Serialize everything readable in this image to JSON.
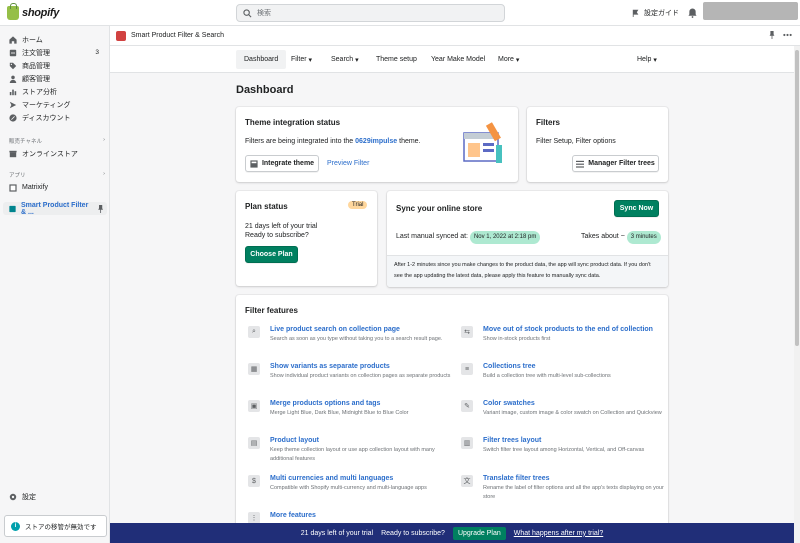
{
  "topbar": {
    "logo": "shopify",
    "search_placeholder": "検索",
    "setup_label": "設定ガイド"
  },
  "sidebar": {
    "items": [
      {
        "label": "ホーム",
        "icon": "home-icon"
      },
      {
        "label": "注文管理",
        "icon": "orders-icon",
        "badge": "3"
      },
      {
        "label": "商品管理",
        "icon": "tag-icon"
      },
      {
        "label": "顧客管理",
        "icon": "person-icon"
      },
      {
        "label": "ストア分析",
        "icon": "analytics-icon"
      },
      {
        "label": "マーケティング",
        "icon": "marketing-icon"
      },
      {
        "label": "ディスカウント",
        "icon": "discount-icon"
      }
    ],
    "channels_heading": "販売チャネル",
    "online_store": "オンラインストア",
    "apps_heading": "アプリ",
    "matrixify": "Matrixify",
    "current_app": "Smart Product Filter & ...",
    "settings": "設定",
    "notice": "ストアの移管が無効です"
  },
  "app_header": {
    "title": "Smart Product Filter & Search"
  },
  "app_nav": {
    "tabs": [
      "Dashboard",
      "Filter",
      "Search",
      "Theme setup",
      "Year Make Model",
      "More"
    ],
    "help": "Help"
  },
  "page": {
    "title": "Dashboard"
  },
  "theme_card": {
    "title": "Theme integration status",
    "text_before": "Filters are being integrated into the",
    "theme_name": "0629impulse",
    "text_after": "theme.",
    "integrate_button": "Integrate theme",
    "preview_link": "Preview Filter"
  },
  "filters_card": {
    "title": "Filters",
    "subtitle": "Filter Setup, Filter options",
    "button": "Manager Filter trees"
  },
  "plan_card": {
    "title": "Plan status",
    "badge": "Trial",
    "line1": "21 days left of your trial",
    "line2": "Ready to subscribe?",
    "button": "Choose Plan"
  },
  "sync_card": {
    "title": "Sync your online store",
    "button": "Sync Now",
    "last_synced_label": "Last manual synced at:",
    "last_synced_value": "Nov 1, 2022 at 2:18 pm",
    "takes_label": "Takes about ~",
    "takes_value": "3 minutes",
    "note": "After 1-2 minutes since you make changes to the product data, the app will sync product data. If you don't see the app updating the latest data, please apply this feature to manually sync data."
  },
  "features": {
    "title": "Filter features",
    "items": [
      {
        "title": "Live product search on collection page",
        "desc": "Search as soon as you type without taking you to a search result page.",
        "icon": "search-icon"
      },
      {
        "title": "Move out of stock products to the end of collection",
        "desc": "Show in-stock products first",
        "icon": "stock-icon"
      },
      {
        "title": "Show variants as separate products",
        "desc": "Show individual product variants on collection pages as separate products",
        "icon": "variants-icon"
      },
      {
        "title": "Collections tree",
        "desc": "Build a collection tree with multi-level sub-collections",
        "icon": "tree-icon"
      },
      {
        "title": "Merge products options and tags",
        "desc": "Merge Light Blue, Dark Blue, Midnight Blue to Blue Color",
        "icon": "merge-icon"
      },
      {
        "title": "Color swatches",
        "desc": "Variant image, custom image & color swatch on Collection and Quickview",
        "icon": "palette-icon"
      },
      {
        "title": "Product layout",
        "desc": "Keep theme collection layout or use app collection layout with many additional features",
        "icon": "layout-icon"
      },
      {
        "title": "Filter trees layout",
        "desc": "Switch filter tree layout among Horizontal, Vertical, and Off-canvas",
        "icon": "columns-icon"
      },
      {
        "title": "Multi currencies and multi languages",
        "desc": "Compatible with Shopify multi-currency and multi-language apps",
        "icon": "currency-icon"
      },
      {
        "title": "Translate filter trees",
        "desc": "Rename the label of filter options and all the app's texts displaying on your store",
        "icon": "translate-icon"
      },
      {
        "title": "More features",
        "desc": "",
        "icon": "grid-icon"
      }
    ]
  },
  "bottom_bar": {
    "trial_text": "21 days left of your trial",
    "ready_text": "Ready to subscribe?",
    "upgrade_button": "Upgrade Plan",
    "link": "What happens after my trial?"
  },
  "colors": {
    "accent": "#008060",
    "link": "#2c6ecb",
    "banner": "#202e78"
  }
}
